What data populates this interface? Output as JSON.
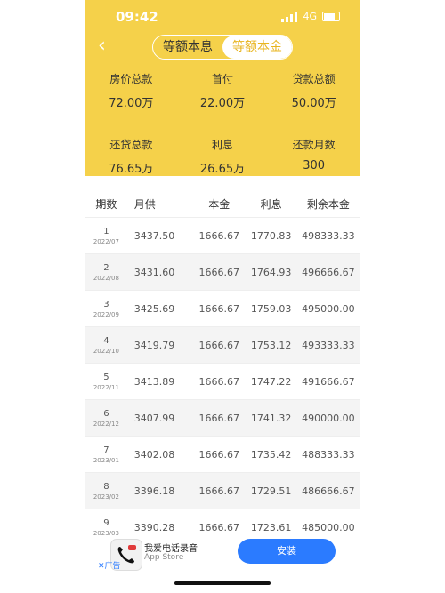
{
  "status": {
    "time": "09:42",
    "network": "4G"
  },
  "header": {
    "toggle": [
      "等额本息",
      "等额本金"
    ],
    "summary": [
      {
        "label": "房价总款",
        "value": "72.00万"
      },
      {
        "label": "首付",
        "value": "22.00万"
      },
      {
        "label": "贷款总额",
        "value": "50.00万"
      },
      {
        "label": "还贷总款",
        "value": "76.65万"
      },
      {
        "label": "利息",
        "value": "26.65万"
      },
      {
        "label": "还款月数",
        "value": "300"
      }
    ]
  },
  "table": {
    "headers": [
      "期数",
      "月供",
      "本金",
      "利息",
      "剩余本金"
    ],
    "rows": [
      {
        "period": "1",
        "date": "2022/07",
        "payment": "3437.50",
        "principal": "1666.67",
        "interest": "1770.83",
        "remaining": "498333.33"
      },
      {
        "period": "2",
        "date": "2022/08",
        "payment": "3431.60",
        "principal": "1666.67",
        "interest": "1764.93",
        "remaining": "496666.67"
      },
      {
        "period": "3",
        "date": "2022/09",
        "payment": "3425.69",
        "principal": "1666.67",
        "interest": "1759.03",
        "remaining": "495000.00"
      },
      {
        "period": "4",
        "date": "2022/10",
        "payment": "3419.79",
        "principal": "1666.67",
        "interest": "1753.12",
        "remaining": "493333.33"
      },
      {
        "period": "5",
        "date": "2022/11",
        "payment": "3413.89",
        "principal": "1666.67",
        "interest": "1747.22",
        "remaining": "491666.67"
      },
      {
        "period": "6",
        "date": "2022/12",
        "payment": "3407.99",
        "principal": "1666.67",
        "interest": "1741.32",
        "remaining": "490000.00"
      },
      {
        "period": "7",
        "date": "2023/01",
        "payment": "3402.08",
        "principal": "1666.67",
        "interest": "1735.42",
        "remaining": "488333.33"
      },
      {
        "period": "8",
        "date": "2023/02",
        "payment": "3396.18",
        "principal": "1666.67",
        "interest": "1729.51",
        "remaining": "486666.67"
      },
      {
        "period": "9",
        "date": "2023/03",
        "payment": "3390.28",
        "principal": "1666.67",
        "interest": "1723.61",
        "remaining": "485000.00"
      }
    ]
  },
  "ad": {
    "app_name": "我爱电话录音",
    "store": "App Store",
    "close_label": "✕广告",
    "install_label": "安装"
  },
  "colors": {
    "header_bg": "#f5d14a",
    "accent": "#e8b51f",
    "install": "#2b7bff"
  }
}
